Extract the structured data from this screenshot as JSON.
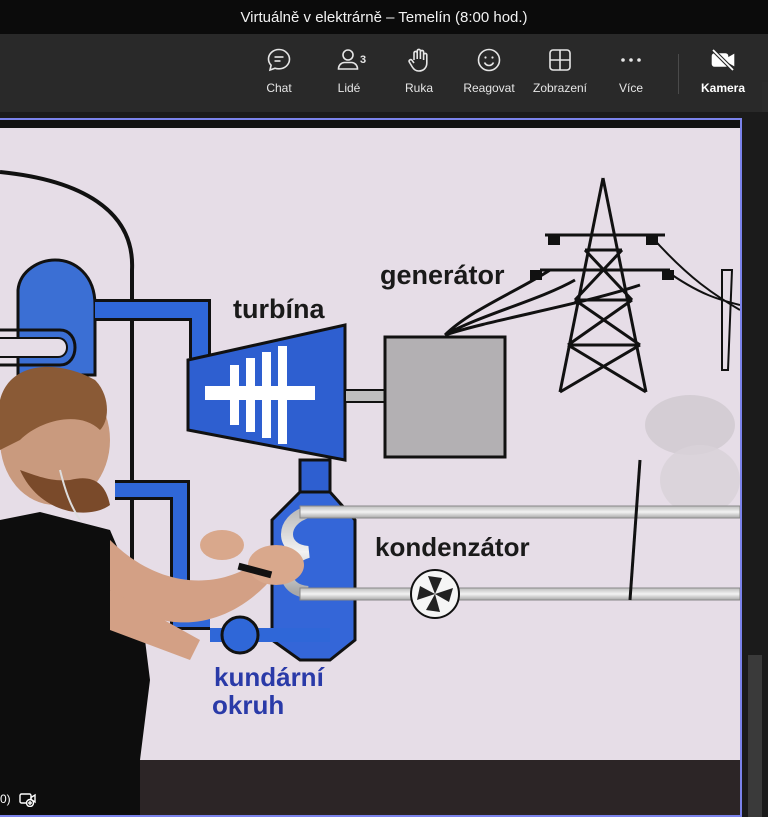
{
  "window": {
    "title": "Virtuálně v elektrárně – Temelín (8:00 hod.)"
  },
  "toolbar": {
    "chat": {
      "label": "Chat",
      "icon": "chat-icon"
    },
    "people": {
      "label": "Lidé",
      "count": "3",
      "icon": "people-icon"
    },
    "raise_hand": {
      "label": "Ruka",
      "icon": "hand-icon"
    },
    "react": {
      "label": "Reagovat",
      "icon": "smiley-icon"
    },
    "view": {
      "label": "Zobrazení",
      "icon": "grid-icon"
    },
    "more": {
      "label": "Více",
      "icon": "more-icon"
    },
    "camera": {
      "label": "Kamera",
      "icon": "camera-off-icon"
    }
  },
  "video": {
    "diagram": {
      "generator_label": "generátor",
      "turbine_label": "turbína",
      "condenser_label": "kondenzátor",
      "secondary_circuit_line1": "kundární",
      "secondary_circuit_line2": "okruh"
    },
    "footer": {
      "left_text": "0)",
      "icon": "add-video-icon"
    }
  },
  "colors": {
    "accent": "#7b83eb",
    "toolbar_bg": "#292929",
    "titlebar_bg": "#0b0b0b",
    "pipe_blue": "#1f5fd6",
    "label_blue": "#2a3aa8"
  }
}
